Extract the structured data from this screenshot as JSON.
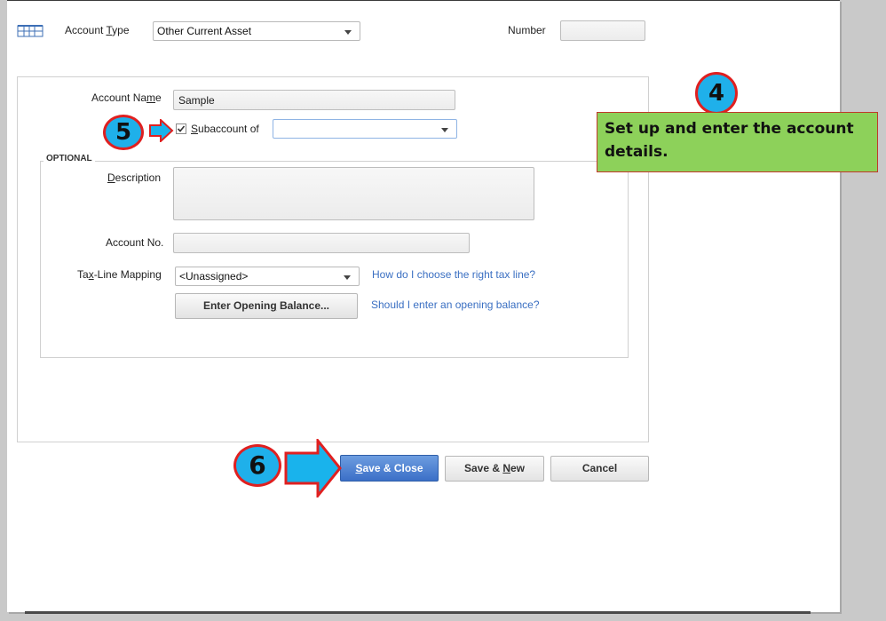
{
  "header": {
    "account_type_label_pre": "Account ",
    "account_type_label_ul": "T",
    "account_type_label_post": "ype",
    "account_type_value": "Other Current Asset",
    "number_label": "Number",
    "number_value": ""
  },
  "form": {
    "account_name_label_pre": "Account Na",
    "account_name_label_ul": "m",
    "account_name_label_post": "e",
    "account_name_value": "Sample",
    "subaccount_checked": true,
    "subaccount_label_ul": "S",
    "subaccount_label_post": "ubaccount of",
    "subaccount_value": ""
  },
  "optional": {
    "section_title": "OPTIONAL",
    "description_label_ul": "D",
    "description_label_post": "escription",
    "description_value": "",
    "account_no_label": "Account No.",
    "account_no_value": "",
    "tax_line_label_pre": "Ta",
    "tax_line_label_ul": "x",
    "tax_line_label_post": "-Line Mapping",
    "tax_line_value": "<Unassigned>",
    "tax_line_help_link": "How do I choose the right tax line?",
    "opening_balance_button_pre": "Enter Openin",
    "opening_balance_button_ul": "g",
    "opening_balance_button_post": " Balance...",
    "opening_balance_help_link": "Should I enter an opening balance?"
  },
  "buttons": {
    "save_close_pre": "",
    "save_close_ul": "S",
    "save_close_post": "ave & Close",
    "save_new_pre": "Save & ",
    "save_new_ul": "N",
    "save_new_post": "ew",
    "cancel": "Cancel"
  },
  "annotations": {
    "step4_number": "4",
    "step4_text": "Set up and enter the account details.",
    "step5_number": "5",
    "step6_number": "6"
  },
  "colors": {
    "callout_fill": "#8dd15a",
    "callout_border": "#c0392b",
    "step_circle_fill": "#1fb0ea",
    "step_circle_border": "#e02020",
    "arrow_fill": "#19b3ec",
    "arrow_border": "#e02020",
    "link": "#3a6fc2",
    "primary_button": "#3b6fc7"
  },
  "icons": {
    "account_type": "grid-register-icon",
    "dropdown": "chevron-down-icon",
    "checkbox": "checkmark-icon",
    "arrow": "right-arrow-icon"
  }
}
